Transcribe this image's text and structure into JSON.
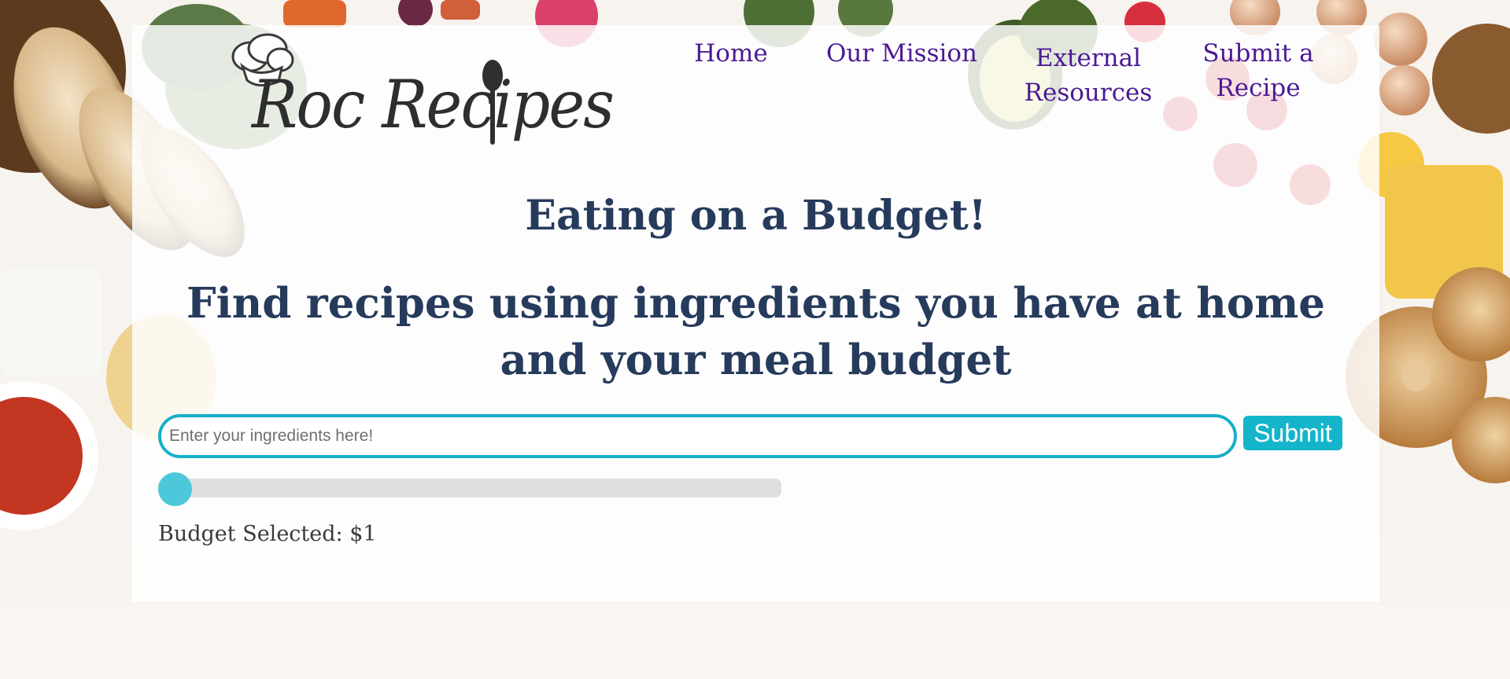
{
  "logo": {
    "text": "Roc Recipes"
  },
  "nav": {
    "home": "Home",
    "mission": "Our Mission",
    "resources_line1": "External",
    "resources_line2": "Resources",
    "submit_line1": "Submit a",
    "submit_line2": "Recipe"
  },
  "main": {
    "title": "Eating on a Budget!",
    "subtitle": "Find recipes using ingredients you have at home and your meal budget"
  },
  "search": {
    "placeholder": "Enter your ingredients here!",
    "value": "",
    "submit_label": "Submit"
  },
  "budget": {
    "slider_fraction": 0,
    "label": "Budget Selected: $1"
  },
  "colors": {
    "accent": "#17b0c8",
    "nav_text": "#4b1a93",
    "heading": "#263b5c"
  },
  "icons": {
    "logo_hat": "chef-hat-icon",
    "logo_spoon": "spoon-icon"
  }
}
